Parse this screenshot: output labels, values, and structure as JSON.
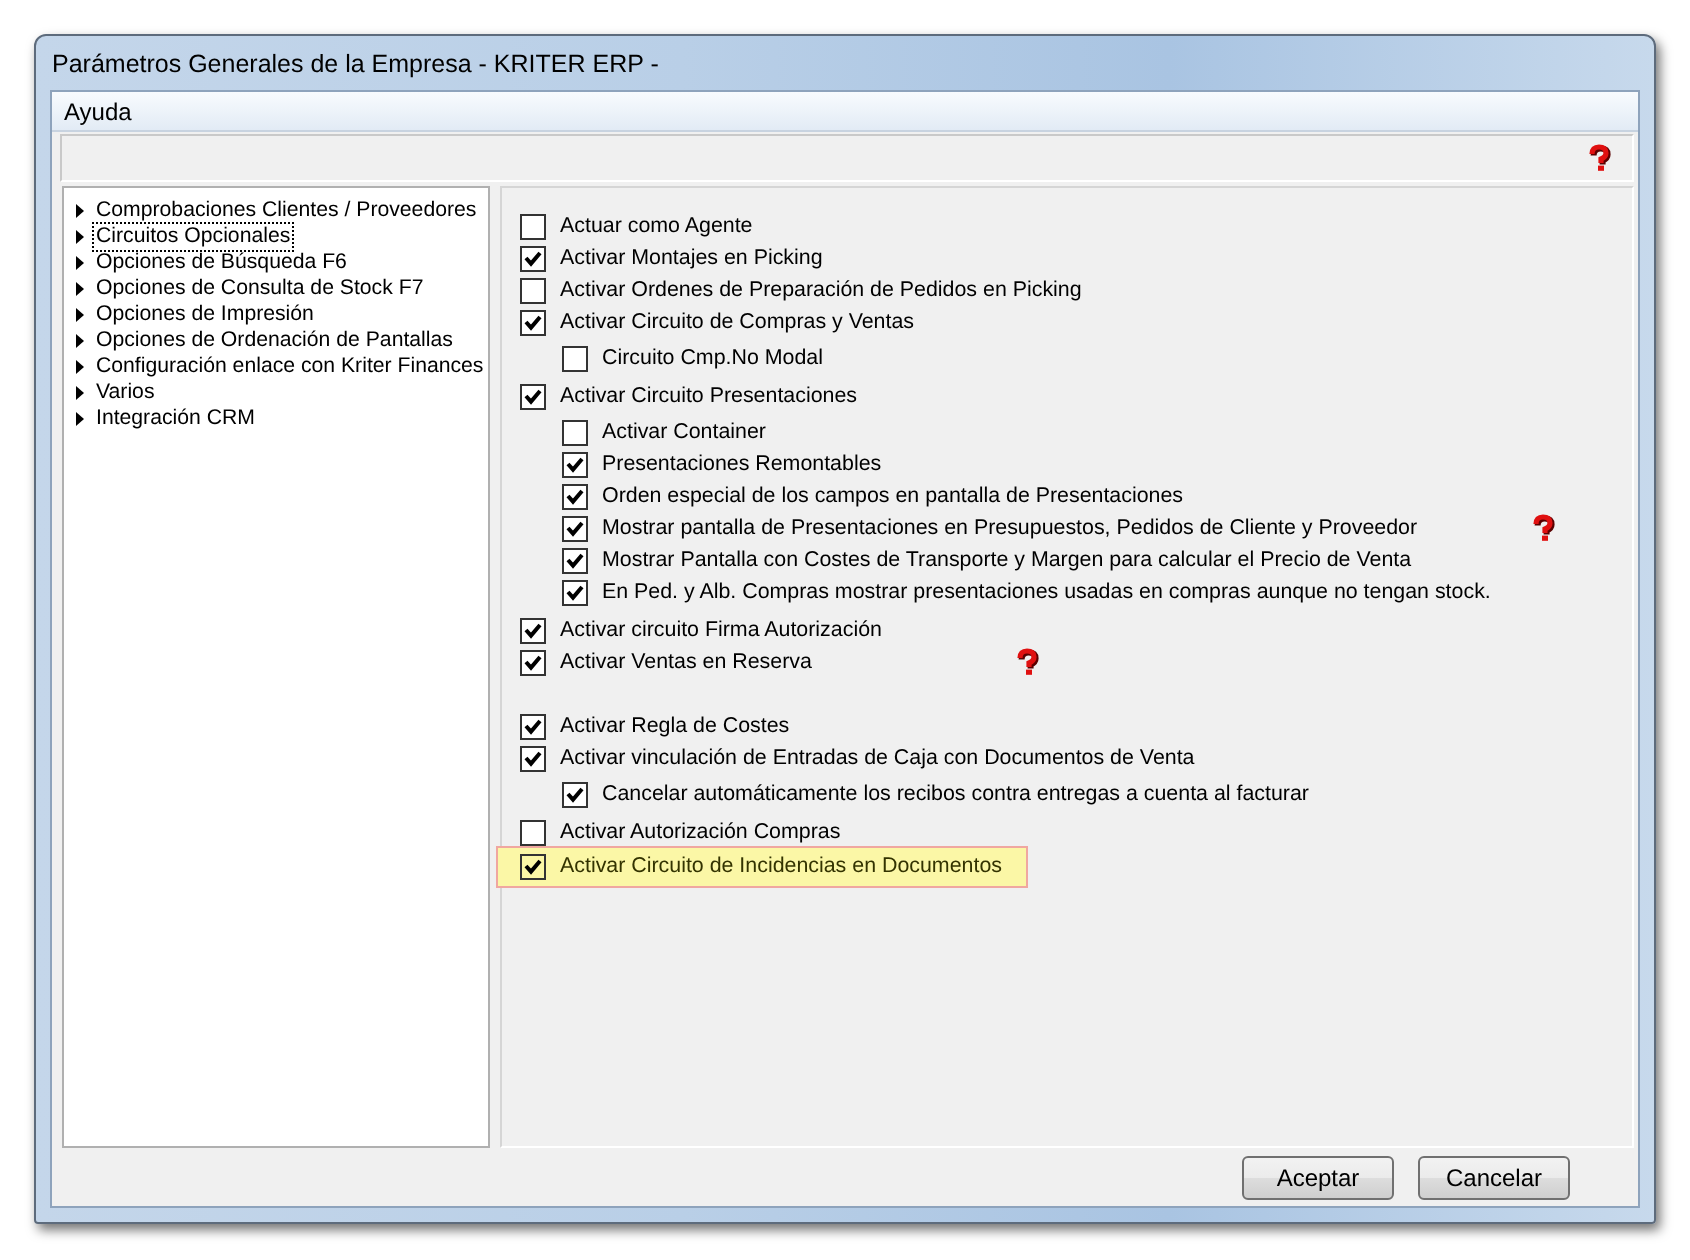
{
  "window": {
    "title": "Parámetros Generales de la Empresa - KRITER ERP -"
  },
  "menu": [
    "Ayuda"
  ],
  "toolbar": {
    "help": true
  },
  "tree": [
    {
      "label": "Comprobaciones Clientes / Proveedores",
      "selected": false
    },
    {
      "label": "Circuitos Opcionales",
      "selected": true
    },
    {
      "label": "Opciones de Búsqueda F6",
      "selected": false
    },
    {
      "label": "Opciones de Consulta de Stock F7",
      "selected": false
    },
    {
      "label": "Opciones de Impresión",
      "selected": false
    },
    {
      "label": "Opciones de Ordenación de Pantallas",
      "selected": false
    },
    {
      "label": "Configuración enlace con Kriter Finances",
      "selected": false
    },
    {
      "label": "Varios",
      "selected": false
    },
    {
      "label": "Integración CRM",
      "selected": false
    }
  ],
  "options": [
    {
      "label": "Actuar como Agente",
      "checked": false
    },
    {
      "label": "Activar Montajes en Picking",
      "checked": true
    },
    {
      "label": "Activar Ordenes de Preparación de Pedidos en Picking",
      "checked": false
    },
    {
      "label": "Activar Circuito de Compras y Ventas",
      "checked": true,
      "children": [
        {
          "label": "Circuito Cmp.No Modal",
          "checked": false
        }
      ]
    },
    {
      "label": "Activar Circuito Presentaciones",
      "checked": true,
      "children": [
        {
          "label": "Activar Container",
          "checked": false
        },
        {
          "label": "Presentaciones Remontables",
          "checked": true
        },
        {
          "label": "Orden especial de los campos en pantalla de Presentaciones",
          "checked": true
        },
        {
          "label": "Mostrar pantalla de Presentaciones en Presupuestos, Pedidos de Cliente y Proveedor",
          "checked": true,
          "help": true
        },
        {
          "label": "Mostrar Pantalla con Costes de Transporte y Margen para calcular el Precio de Venta",
          "checked": true
        },
        {
          "label": "En Ped. y Alb. Compras mostrar presentaciones usadas en compras aunque no tengan stock.",
          "checked": true
        }
      ]
    },
    {
      "label": "Activar circuito Firma Autorización",
      "checked": true
    },
    {
      "label": "Activar Ventas en Reserva",
      "checked": true,
      "help": true
    },
    {
      "label": "Activar Regla de Costes",
      "checked": true,
      "gap_before": true
    },
    {
      "label": "Activar vinculación de Entradas de Caja con Documentos de Venta",
      "checked": true,
      "children": [
        {
          "label": "Cancelar automáticamente los recibos contra entregas a cuenta al facturar",
          "checked": true
        }
      ]
    },
    {
      "label": "Activar Autorización Compras",
      "checked": false
    },
    {
      "label": "Activar Circuito de Incidencias en Documentos",
      "checked": true,
      "highlighted": true
    }
  ],
  "buttons": [
    "Aceptar",
    "Cancelar"
  ]
}
